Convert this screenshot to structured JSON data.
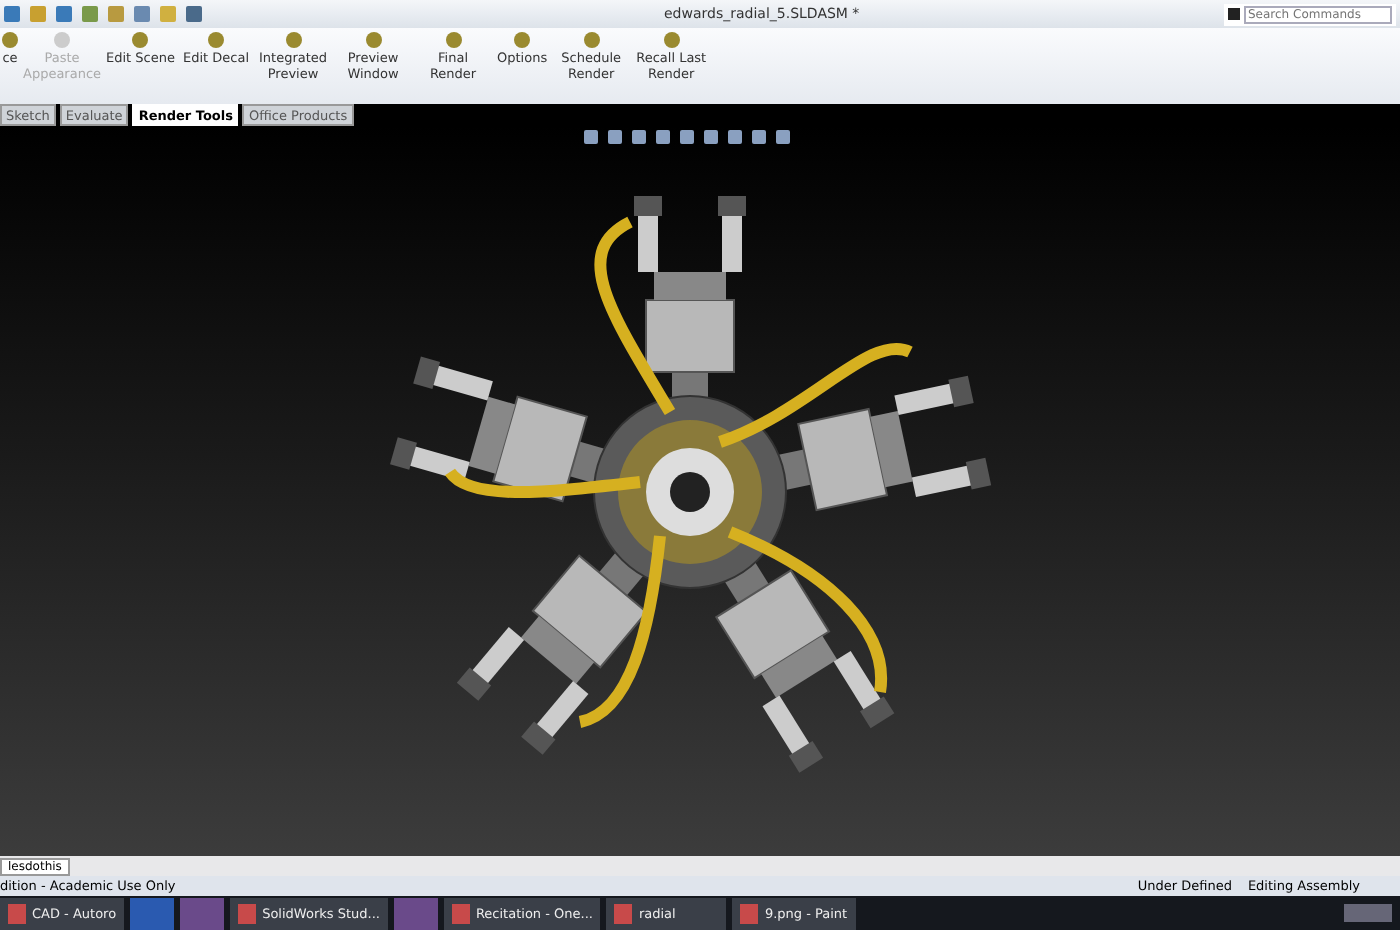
{
  "window": {
    "title": "edwards_radial_5.SLDASM *"
  },
  "search": {
    "placeholder": "Search Commands"
  },
  "ribbon": [
    {
      "label": "ce",
      "disabled": false
    },
    {
      "label": "Paste Appearance",
      "disabled": true
    },
    {
      "label": "Edit Scene",
      "disabled": false
    },
    {
      "label": "Edit Decal",
      "disabled": false
    },
    {
      "label": "Integrated Preview",
      "disabled": false
    },
    {
      "label": "Preview Window",
      "disabled": false
    },
    {
      "label": "Final Render",
      "disabled": false
    },
    {
      "label": "Options",
      "disabled": false
    },
    {
      "label": "Schedule Render",
      "disabled": false
    },
    {
      "label": "Recall Last Render",
      "disabled": false
    }
  ],
  "tabs": [
    {
      "label": "Sketch",
      "selected": false
    },
    {
      "label": "Evaluate",
      "selected": false
    },
    {
      "label": "Render Tools",
      "selected": true
    },
    {
      "label": "Office Products",
      "selected": false
    }
  ],
  "bottom_tab": "lesdothis",
  "status_bar": {
    "left": "dition - Academic Use Only",
    "right": [
      "Under Defined",
      "Editing Assembly"
    ]
  },
  "taskbar": [
    {
      "label": "CAD - Autoro",
      "kind": "text"
    },
    {
      "kind": "word"
    },
    {
      "kind": "app"
    },
    {
      "label": "SolidWorks Stud...",
      "kind": "text"
    },
    {
      "kind": "app"
    },
    {
      "label": "Recitation - One...",
      "kind": "text"
    },
    {
      "label": "radial",
      "kind": "text"
    },
    {
      "label": "9.png - Paint",
      "kind": "text"
    }
  ]
}
